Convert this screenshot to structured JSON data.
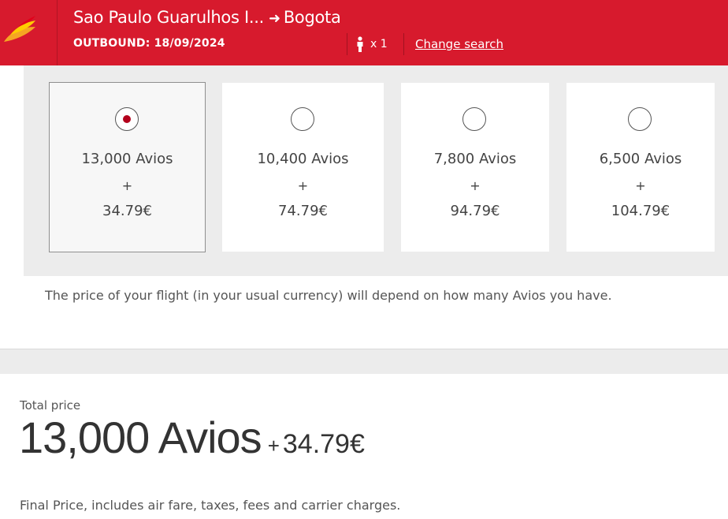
{
  "header": {
    "origin": "Sao Paulo Guarulhos I...",
    "arrow": "➜",
    "destination": "Bogota",
    "outbound": "OUTBOUND: 18/09/2024",
    "passenger_count": "x 1",
    "change_search": "Change search",
    "brand_color": "#d71a2d"
  },
  "options": [
    {
      "avios": "13,000 Avios",
      "plus": "+",
      "cash": "34.79€",
      "selected": true
    },
    {
      "avios": "10,400 Avios",
      "plus": "+",
      "cash": "74.79€",
      "selected": false
    },
    {
      "avios": "7,800 Avios",
      "plus": "+",
      "cash": "94.79€",
      "selected": false
    },
    {
      "avios": "6,500 Avios",
      "plus": "+",
      "cash": "104.79€",
      "selected": false
    }
  ],
  "note": "The price of your flight (in your usual currency) will depend on how many Avios you have.",
  "total": {
    "label": "Total price",
    "avios": "13,000 Avios",
    "plus": "+",
    "cash": "34.79€",
    "final_note": "Final Price, includes air fare, taxes, fees and carrier charges."
  },
  "icons": {
    "logo": "iberia-logo-icon",
    "passenger": "person-icon"
  }
}
